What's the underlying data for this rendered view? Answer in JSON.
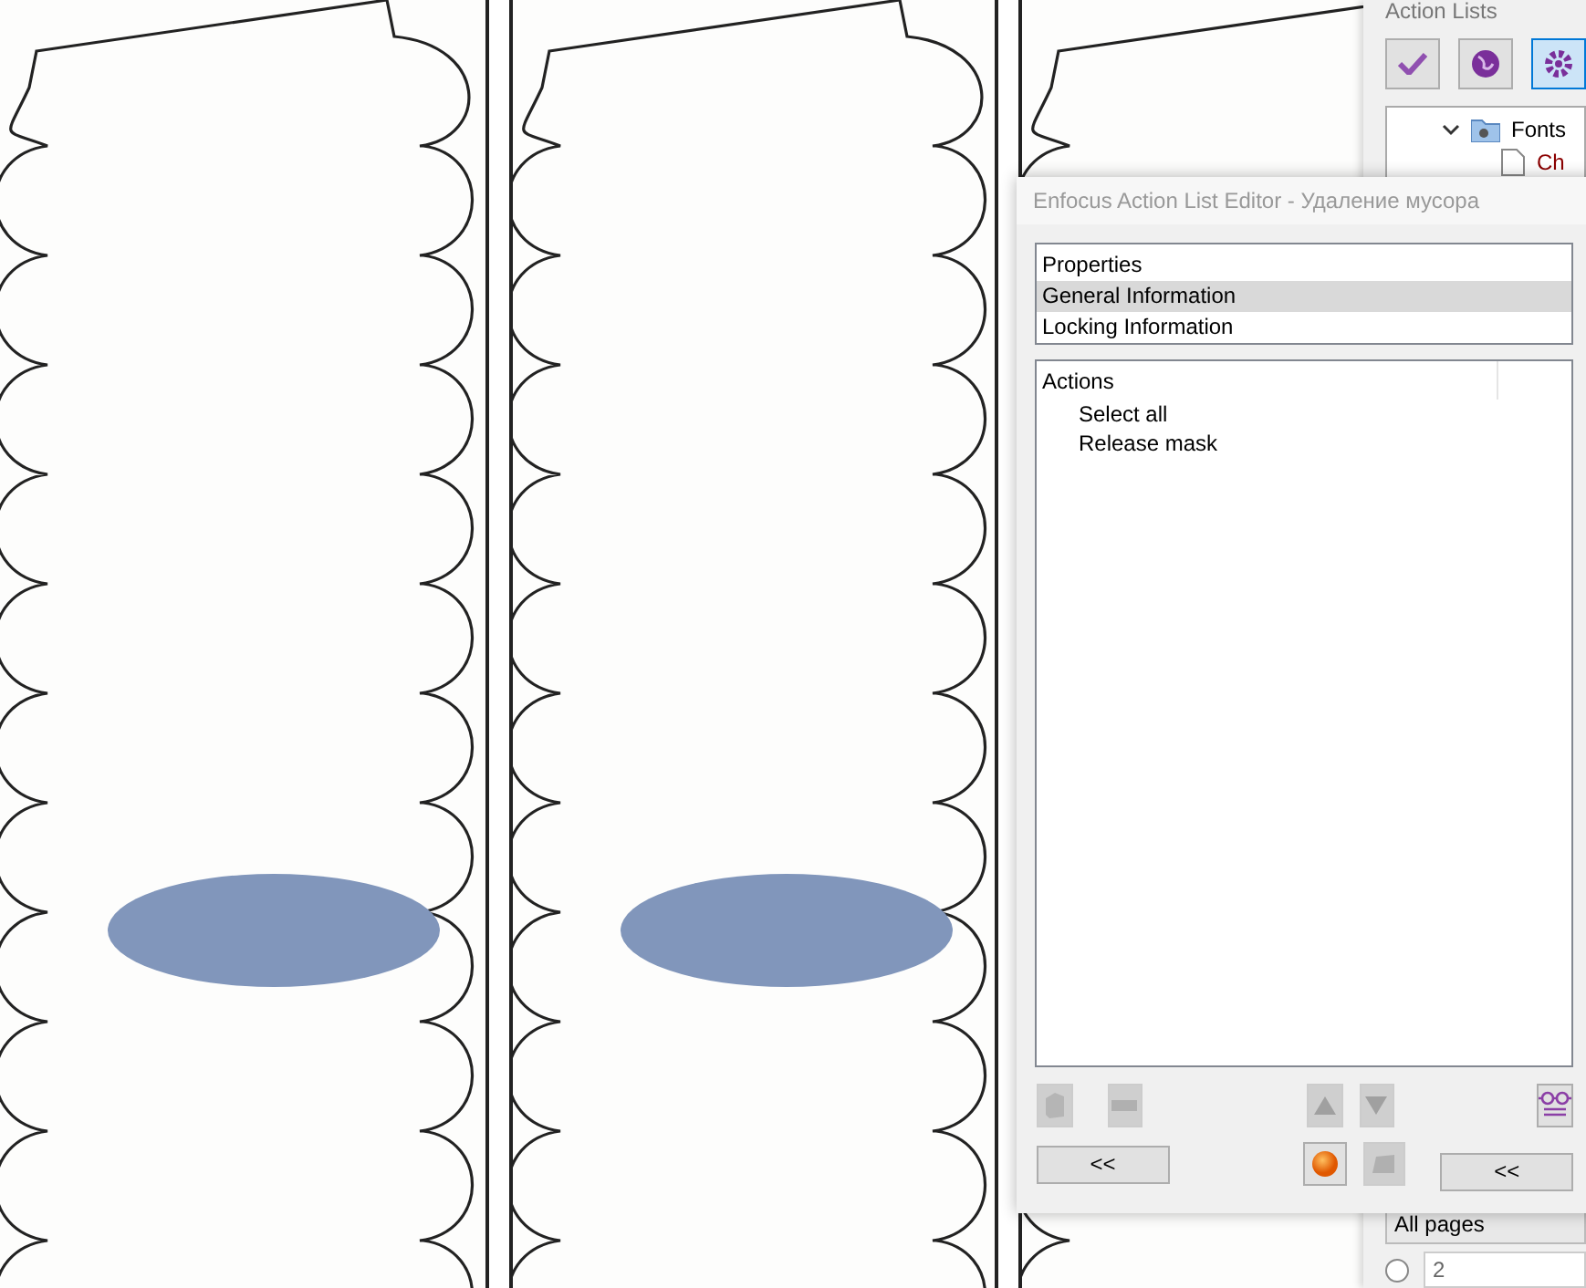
{
  "document": {
    "pages": [
      {
        "kind": "full"
      },
      {
        "kind": "full"
      },
      {
        "kind": "partial"
      }
    ]
  },
  "right_panel": {
    "title": "Action Lists",
    "toolbar": [
      {
        "kind": "check",
        "selected": false
      },
      {
        "kind": "globe",
        "selected": false
      },
      {
        "kind": "gear",
        "selected": true
      }
    ],
    "tree": [
      {
        "label": "Fonts",
        "expanded": true,
        "children": [
          {
            "label": "Ch"
          }
        ]
      }
    ],
    "page_range": {
      "value": "All pages"
    },
    "page_option": {
      "selected": false,
      "value": "2"
    }
  },
  "editor": {
    "title": "Enfocus Action List Editor - Удаление мусора",
    "properties": {
      "header": "Properties",
      "items": [
        {
          "label": "General Information",
          "selected": true
        },
        {
          "label": "Locking Information",
          "selected": false
        }
      ]
    },
    "actions": {
      "header": "Actions",
      "items": [
        {
          "label": "Select all"
        },
        {
          "label": "Release mask"
        }
      ]
    },
    "tools": [
      {
        "kind": "add",
        "disabled": true
      },
      {
        "kind": "remove",
        "disabled": true
      },
      {
        "kind": "up",
        "disabled": true
      },
      {
        "kind": "down",
        "disabled": true
      },
      {
        "kind": "preview",
        "disabled": false
      }
    ],
    "bottom_tools": [
      {
        "kind": "run",
        "disabled": false
      },
      {
        "kind": "stop",
        "disabled": true
      }
    ],
    "collapse_left": "<<",
    "collapse_right": "<<"
  }
}
